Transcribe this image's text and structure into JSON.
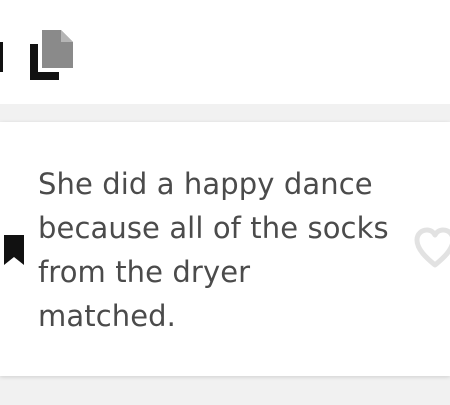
{
  "toolbar": {
    "copy_icon": "copy-icon"
  },
  "quote_card": {
    "text": "She did a happy dance\nbecause all of the socks\nfrom the dryer\nmatched.",
    "bookmark_icon": "bookmark-icon",
    "like_icon": "heart-outline-icon"
  },
  "colors": {
    "background": "#f1f1f1",
    "card": "#ffffff",
    "text": "#4b4b4b",
    "copy_front": "#111111",
    "copy_back": "#8a8a8a",
    "bookmark": "#111111",
    "heart_outline": "#e2e2e2"
  }
}
